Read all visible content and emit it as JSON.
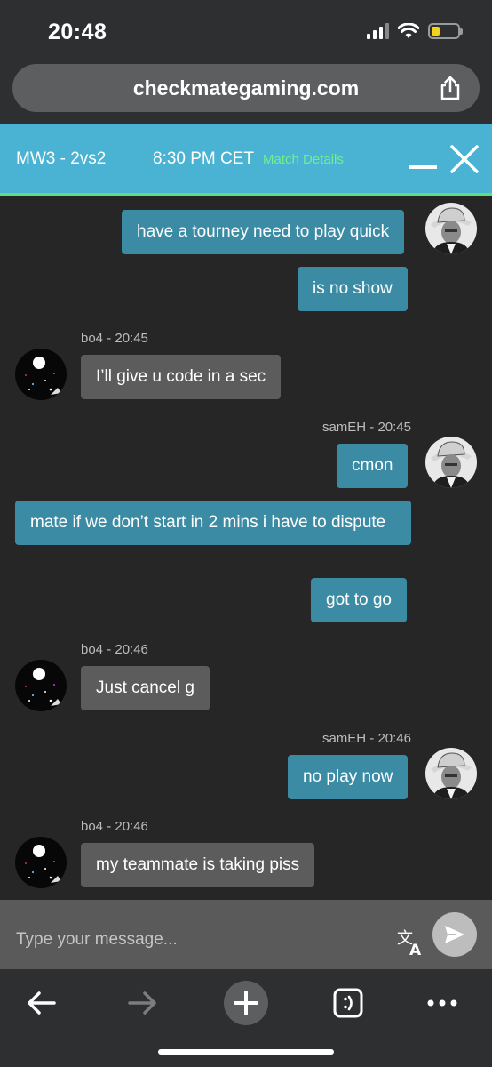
{
  "status_bar": {
    "time": "20:48"
  },
  "browser": {
    "url": "checkmategaming.com"
  },
  "chat_header": {
    "game": "MW3 - 2vs2",
    "time": "8:30 PM CET",
    "details_link": "Match Details"
  },
  "messages": [
    {
      "sender": "samEH",
      "text": "have a tourney need to play quick"
    },
    {
      "sender": "samEH",
      "text": "is no show"
    },
    {
      "sender": "bo4",
      "meta": "bo4 - 20:45",
      "text": "I’ll give u code in a sec"
    },
    {
      "sender": "samEH",
      "meta": "samEH - 20:45",
      "text": "cmon"
    },
    {
      "sender": "samEH",
      "text": "mate if we don’t start in 2 mins i have to dispute"
    },
    {
      "sender": "samEH",
      "text": "got to go"
    },
    {
      "sender": "bo4",
      "meta": "bo4 - 20:46",
      "text": "Just cancel g"
    },
    {
      "sender": "samEH",
      "meta": "samEH - 20:46",
      "text": "no play now"
    },
    {
      "sender": "bo4",
      "meta": "bo4 - 20:46",
      "text": "my teammate is taking piss"
    }
  ],
  "composer": {
    "placeholder": "Type your message..."
  },
  "colors": {
    "header": "#4ab3d3",
    "my_bubble": "#3b8ba5",
    "their_bubble": "#5c5c5c",
    "match_details": "#6ef08e"
  }
}
